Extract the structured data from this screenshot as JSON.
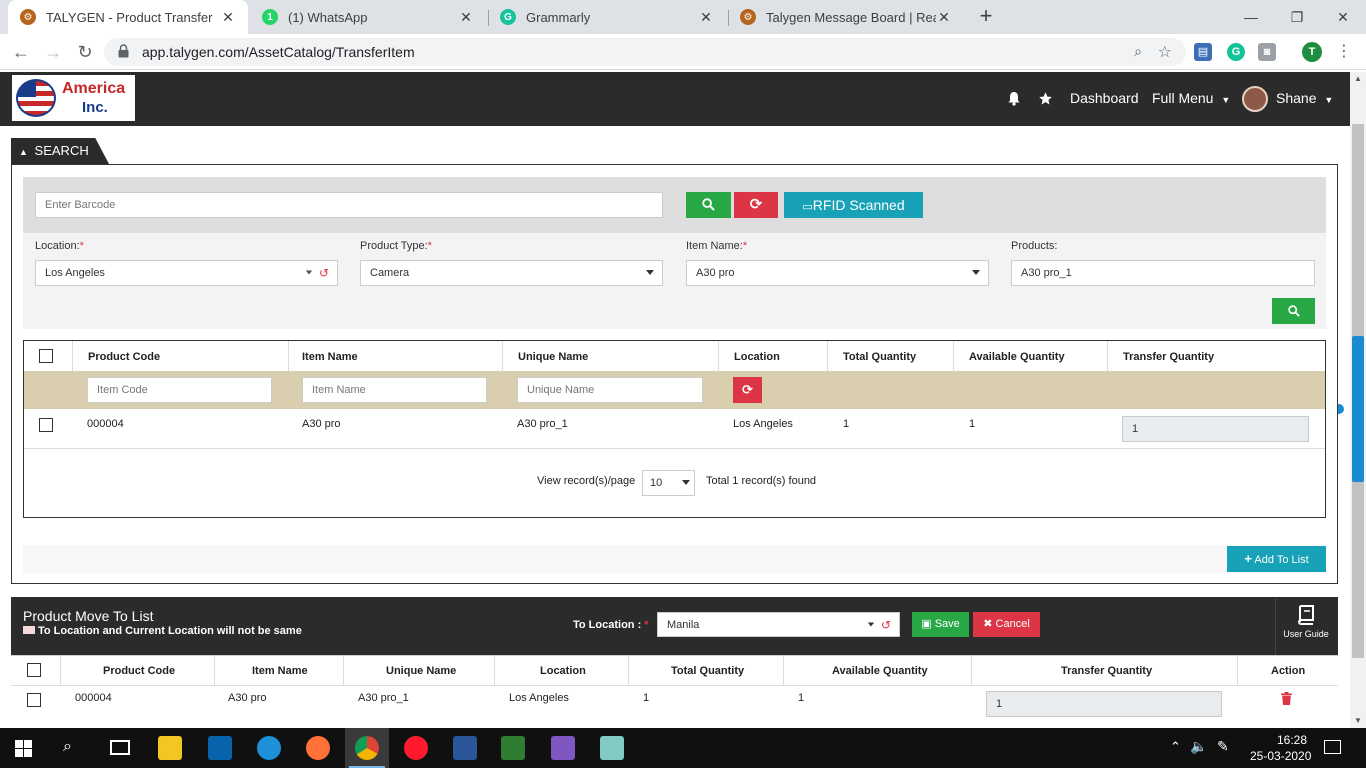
{
  "browser": {
    "tabs": [
      {
        "title": "TALYGEN - Product Transfer",
        "active": true
      },
      {
        "title": "(1) WhatsApp",
        "active": false
      },
      {
        "title": "Grammarly",
        "active": false
      },
      {
        "title": "Talygen Message Board | Real Tin",
        "active": false
      }
    ],
    "url": "app.talygen.com/AssetCatalog/TransferItem",
    "profile_initial": "T"
  },
  "app": {
    "logo_line1": "America",
    "logo_line2": "Inc.",
    "dashboard": "Dashboard",
    "full_menu": "Full Menu",
    "user": "Shane"
  },
  "search": {
    "tab_label": "SEARCH",
    "barcode_placeholder": "Enter Barcode",
    "rfid_label": "RFID Scanned",
    "location_label": "Location:",
    "location_value": "Los Angeles",
    "product_type_label": "Product Type:",
    "product_type_value": "Camera",
    "item_name_label": "Item Name:",
    "item_name_value": "A30 pro",
    "products_label": "Products:",
    "products_value": "A30 pro_1",
    "required_mark": "*"
  },
  "results": {
    "columns": [
      "Product Code",
      "Item Name",
      "Unique Name",
      "Location",
      "Total Quantity",
      "Available Quantity",
      "Transfer Quantity"
    ],
    "filters": {
      "code": "Item Code",
      "item": "Item Name",
      "unique": "Unique Name"
    },
    "rows": [
      {
        "code": "000004",
        "item": "A30 pro",
        "unique": "A30 pro_1",
        "location": "Los Angeles",
        "total": "1",
        "available": "1",
        "transfer": "1"
      }
    ],
    "per_page_label": "View record(s)/page",
    "per_page": "10",
    "total_found": "Total 1 record(s) found",
    "add_to_list": "Add To List"
  },
  "move": {
    "title": "Product Move To List",
    "note": "To Location and Current Location will not be same",
    "to_location_label": "To Location :",
    "to_location_value": "Manila",
    "save": "Save",
    "cancel": "Cancel",
    "user_guide": "User Guide",
    "columns": [
      "Product Code",
      "Item Name",
      "Unique Name",
      "Location",
      "Total Quantity",
      "Available Quantity",
      "Transfer Quantity",
      "Action"
    ],
    "rows": [
      {
        "code": "000004",
        "item": "A30 pro",
        "unique": "A30 pro_1",
        "location": "Los Angeles",
        "total": "1",
        "available": "1",
        "transfer": "1"
      }
    ]
  },
  "taskbar": {
    "time": "16:28",
    "date": "25-03-2020"
  },
  "colors": {
    "header": "#2b2b2b",
    "green": "#28a745",
    "red": "#dc3545",
    "teal": "#17a2b8",
    "filter_row": "#d9cfae"
  }
}
